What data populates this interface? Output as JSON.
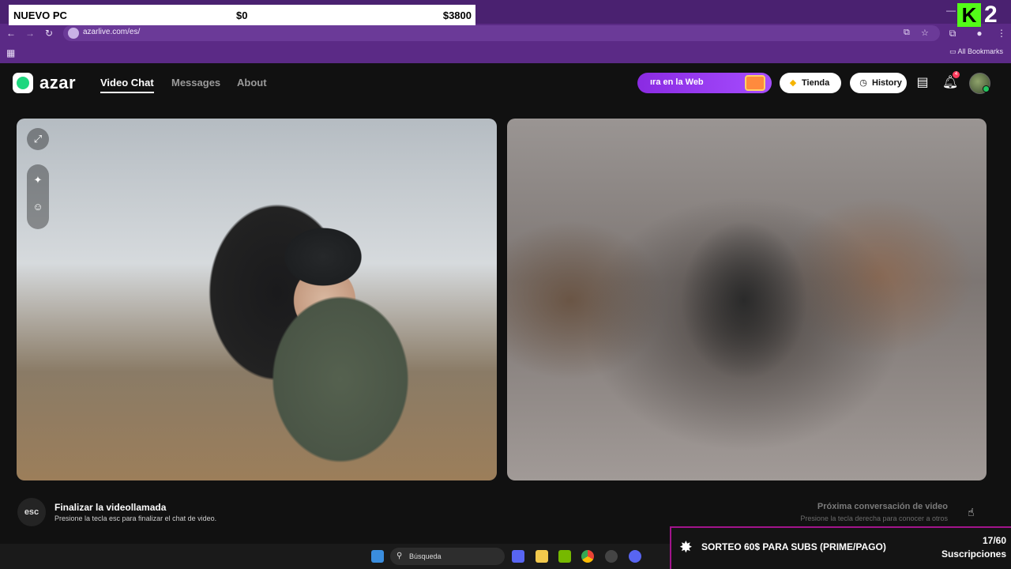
{
  "overlay": {
    "goal_title": "NUEVO PC",
    "goal_current": "$0",
    "goal_target": "$3800",
    "kick_count": "2",
    "sub_goal_title": "SORTEO 60$ PARA SUBS (PRIME/PAGO)",
    "sub_goal_count": "17/60",
    "sub_goal_label": "Suscripciones"
  },
  "browser": {
    "url": "azarlive.com/es/",
    "bookmarks_label": "All Bookmarks"
  },
  "header": {
    "logo_text": "azar",
    "nav": [
      "Video Chat",
      "Messages",
      "About"
    ],
    "promo_text": "ıra en la Web",
    "shop_label": "Tienda",
    "history_label": "History",
    "notification_count": "4"
  },
  "tools": {
    "expand_icon": "expand-icon",
    "effects_icon": "magic-wand-icon",
    "sticker_icon": "smiley-icon"
  },
  "controls": {
    "esc_label": "esc",
    "end_title": "Finalizar la videollamada",
    "end_sub": "Presione la tecla esc para finalizar el chat de video.",
    "next_title": "Próxima conversación de video",
    "next_sub": "Presione la tecla derecha para conocer a otros"
  },
  "taskbar": {
    "search_placeholder": "Búsqueda"
  },
  "colors": {
    "browser_chrome": "#5b2a86",
    "app_bg": "#111111",
    "promo_purple": "#8a2be2",
    "kick_green": "#53fc18",
    "sub_border": "#a2148c"
  }
}
